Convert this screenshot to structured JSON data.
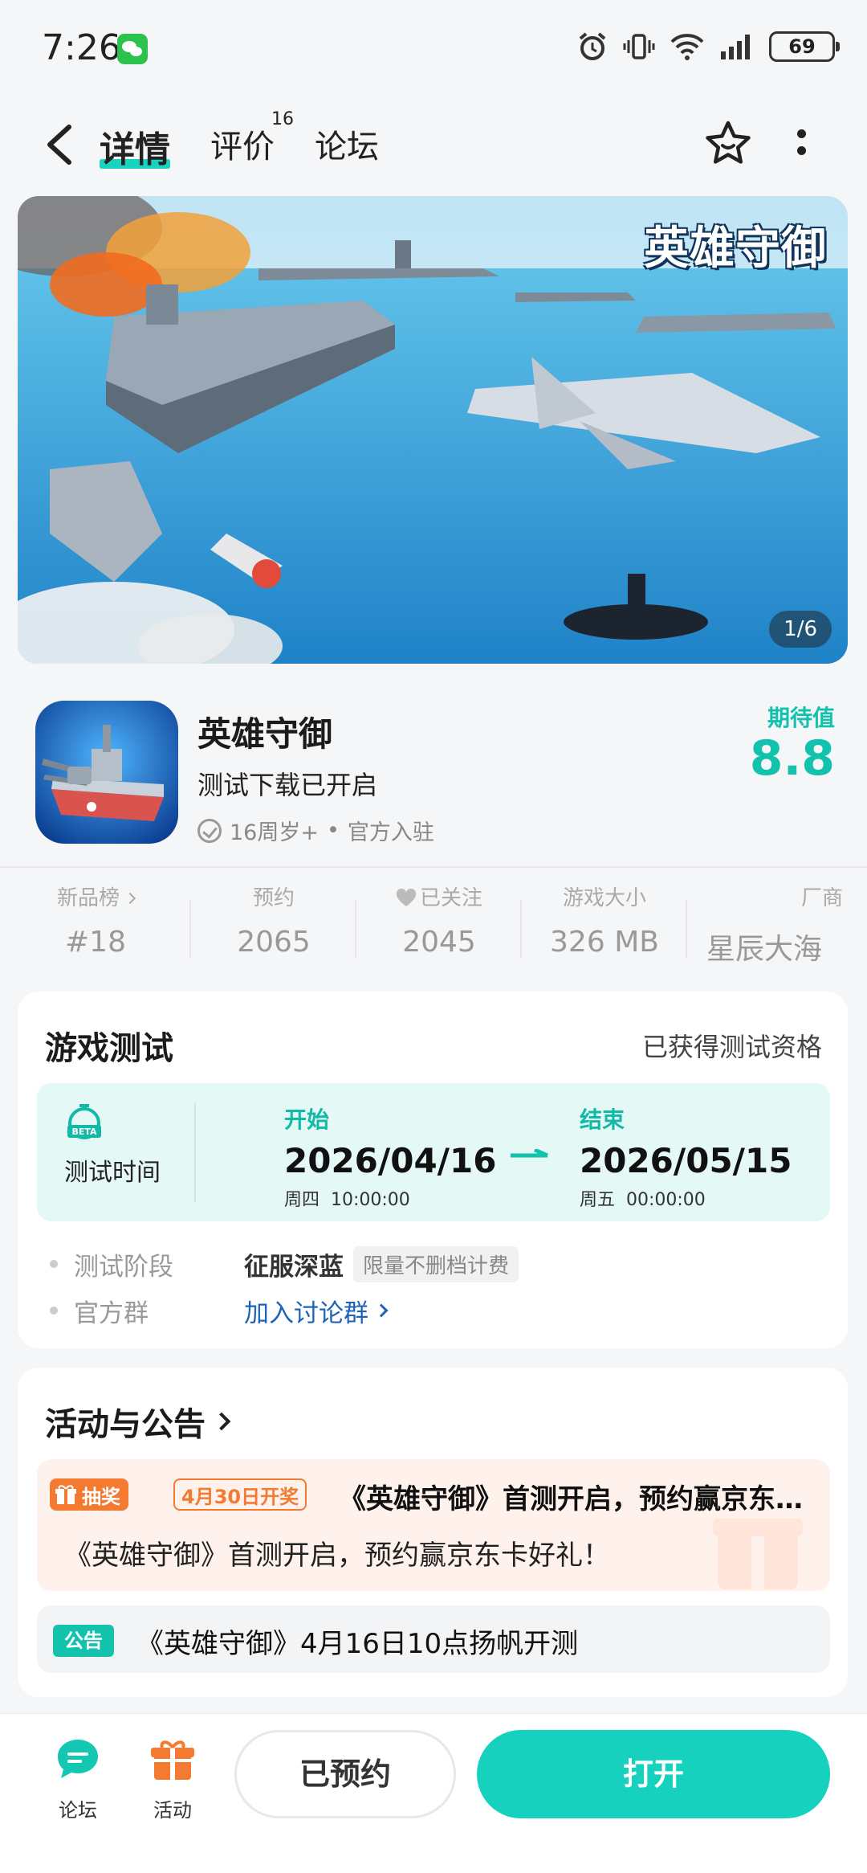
{
  "status_bar": {
    "time": "7:26",
    "battery": "69"
  },
  "nav": {
    "tabs": [
      {
        "label": "详情",
        "active": true
      },
      {
        "label": "评价",
        "badge": "16"
      },
      {
        "label": "论坛"
      }
    ]
  },
  "banner": {
    "logo_text": "英雄守御",
    "counter": "1/6"
  },
  "app": {
    "name": "英雄守御",
    "tagline": "测试下载已开启",
    "age_rating": "16周岁+",
    "separator": "•",
    "certification": "官方入驻",
    "expect_label": "期待值",
    "expect_score": "8.8"
  },
  "stats": [
    {
      "label": "新品榜",
      "value": "#18"
    },
    {
      "label": "预约",
      "value": "2065"
    },
    {
      "label": "已关注",
      "value": "2045"
    },
    {
      "label": "游戏大小",
      "value": "326 MB"
    },
    {
      "label": "厂商",
      "value": "星辰大海"
    }
  ],
  "test": {
    "title": "游戏测试",
    "status": "已获得测试资格",
    "beta_text": "BETA",
    "time_label": "测试时间",
    "start_label": "开始",
    "start_date": "2026/04/16",
    "start_sub": "周四  10:00:00",
    "end_label": "结束",
    "end_date": "2026/05/15",
    "end_sub": "周五  00:00:00",
    "phase_key": "测试阶段",
    "phase_value": "征服深蓝",
    "phase_tag": "限量不删档计费",
    "group_key": "官方群",
    "group_link": "加入讨论群"
  },
  "events": {
    "title": "活动与公告",
    "lottery_tag": "抽奖",
    "date_tag": "4月30日开奖",
    "promo_title": "《英雄守御》首测开启，预约赢京东卡好礼！",
    "promo_body": "《英雄守御》首测开启，预约赢京东卡好礼！",
    "notice_tag": "公告",
    "notice_text": "《英雄守御》4月16日10点扬帆开测"
  },
  "bottom": {
    "forum_label": "论坛",
    "events_label": "活动",
    "reserved_label": "已预约",
    "open_label": "打开"
  },
  "colors": {
    "accent": "#15d1bd",
    "orange": "#f47a32",
    "link": "#1e63b8"
  }
}
